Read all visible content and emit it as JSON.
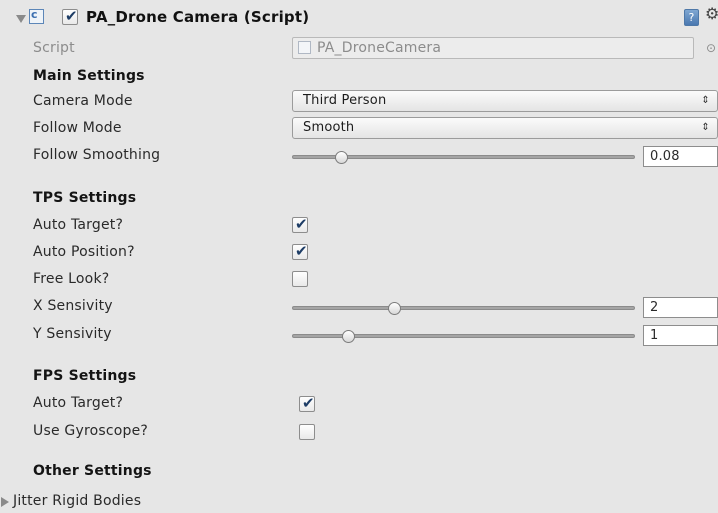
{
  "component": {
    "title": "PA_Drone Camera (Script)",
    "enabled": true,
    "script_label": "Script",
    "script_value": "PA_DroneCamera"
  },
  "main_settings": {
    "header": "Main Settings",
    "camera_mode_label": "Camera Mode",
    "camera_mode_value": "Third Person",
    "follow_mode_label": "Follow Mode",
    "follow_mode_value": "Smooth",
    "follow_smoothing_label": "Follow Smoothing",
    "follow_smoothing_value": "0.08",
    "follow_smoothing_fraction": 0.13
  },
  "tps_settings": {
    "header": "TPS Settings",
    "auto_target_label": "Auto Target?",
    "auto_target": true,
    "auto_position_label": "Auto Position?",
    "auto_position": true,
    "free_look_label": "Free Look?",
    "free_look": false,
    "x_sensivity_label": "X Sensivity",
    "x_sensivity_value": "2",
    "x_sensivity_fraction": 0.29,
    "y_sensivity_label": "Y Sensivity",
    "y_sensivity_value": "1",
    "y_sensivity_fraction": 0.15
  },
  "fps_settings": {
    "header": "FPS Settings",
    "auto_target_label": "Auto Target?",
    "auto_target": true,
    "use_gyroscope_label": "Use Gyroscope?",
    "use_gyroscope": false
  },
  "other_settings": {
    "header": "Other Settings",
    "jitter_label": "Jitter Rigid Bodies"
  },
  "icons": {
    "checkmark": "✔",
    "dropdown_arrows": "⇕",
    "gear": "⚙",
    "help": "?",
    "object_picker": "⊙"
  }
}
